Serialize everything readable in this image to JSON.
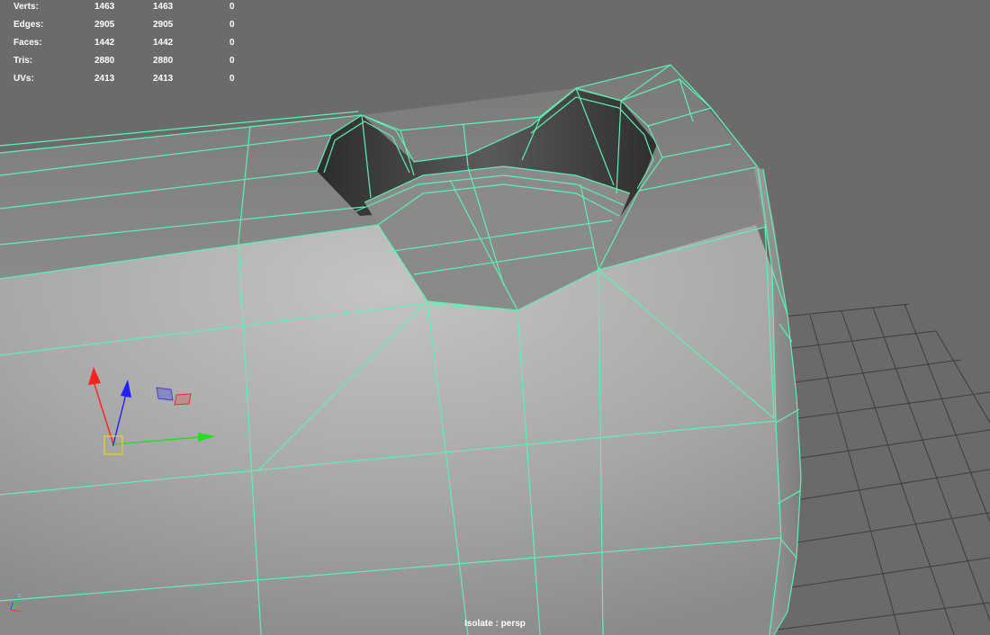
{
  "hud": {
    "rows": [
      {
        "label": "Verts:",
        "total": "1463",
        "selected": "1463",
        "other": "0"
      },
      {
        "label": "Edges:",
        "total": "2905",
        "selected": "2905",
        "other": "0"
      },
      {
        "label": "Faces:",
        "total": "1442",
        "selected": "1442",
        "other": "0"
      },
      {
        "label": "Tris:",
        "total": "2880",
        "selected": "2880",
        "other": "0"
      },
      {
        "label": "UVs:",
        "total": "2413",
        "selected": "2413",
        "other": "0"
      }
    ]
  },
  "viewport": {
    "camera_label": "Isolate : persp",
    "axis_labels": {
      "z": "z",
      "x": "x"
    },
    "colors": {
      "background": "#6b6b6b",
      "wireframe": "#5ff0b4",
      "grid": "#3a3a3a",
      "axis_x": "#ff2020",
      "axis_y": "#20e020",
      "axis_z": "#2020ff",
      "pivot": "#e6d51a"
    }
  }
}
